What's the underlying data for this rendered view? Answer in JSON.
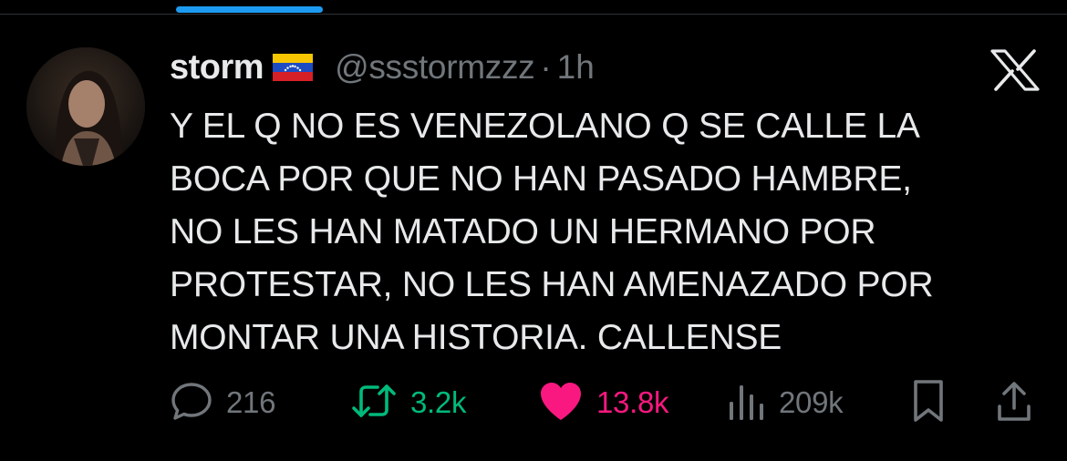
{
  "tweet": {
    "author_name": "storm",
    "flag": "venezuela-flag",
    "handle": "@ssstormzzz",
    "separator": "·",
    "time": "1h",
    "text": "Y EL Q NO ES VENEZOLANO Q SE CALLE LA\nBOCA POR QUE NO HAN PASADO HAMBRE,\nNO LES HAN MATADO UN HERMANO POR\nPROTESTAR, NO LES HAN AMENAZADO POR\nMONTAR UNA HISTORIA. CALLENSE"
  },
  "actions": {
    "replies": "216",
    "reposts": "3.2k",
    "likes": "13.8k",
    "views": "209k"
  },
  "icons": {
    "reply": "speech-bubble-icon",
    "repost": "repost-arrows-icon",
    "like": "heart-filled-icon",
    "views": "bar-chart-icon",
    "bookmark": "bookmark-icon",
    "share": "share-icon",
    "brand": "x-logo-icon"
  },
  "colors": {
    "background": "#000000",
    "text": "#e7e9ea",
    "muted": "#71767b",
    "repost": "#00ba7c",
    "like": "#f91880",
    "accent": "#1d9bf0"
  }
}
